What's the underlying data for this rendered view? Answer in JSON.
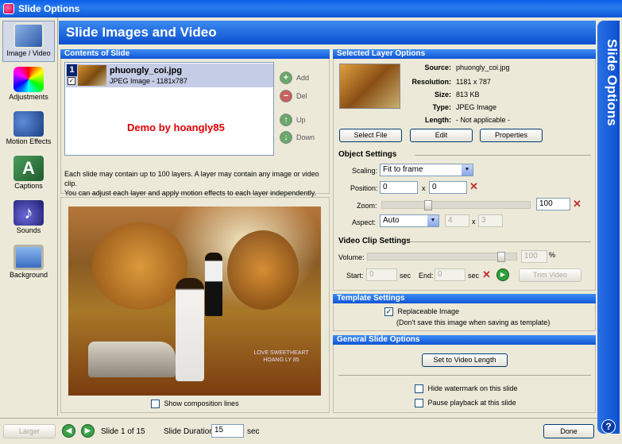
{
  "window": {
    "title": "Slide Options"
  },
  "sidebar": {
    "items": [
      {
        "label": "Image / Video",
        "icon": "image-video-icon"
      },
      {
        "label": "Adjustments",
        "icon": "adjustments-icon"
      },
      {
        "label": "Motion Effects",
        "icon": "motion-effects-icon"
      },
      {
        "label": "Captions",
        "icon": "captions-icon"
      },
      {
        "label": "Sounds",
        "icon": "sounds-icon"
      },
      {
        "label": "Background",
        "icon": "background-icon"
      }
    ]
  },
  "header": {
    "title": "Slide Images and Video",
    "side_title": "Slide Options"
  },
  "contents": {
    "section_title": "Contents of Slide",
    "layer": {
      "number": "1",
      "check": "✓",
      "name": "phuongly_coi.jpg",
      "info": "JPEG Image - 1181x787"
    },
    "demo_text": "Demo by hoangly85",
    "buttons": {
      "add": "Add",
      "del": "Del",
      "up": "Up",
      "down": "Down"
    },
    "info_line1": "Each slide may contain up to 100 layers. A layer may contain any image or video clip.",
    "info_line2": "You can adjust each layer and apply motion effects to each layer independently.",
    "show_composition": "Show composition lines"
  },
  "preview": {
    "watermark_line1": "LOVE SWEETHEART",
    "watermark_line2": "HOANG LY 85"
  },
  "selected_layer": {
    "section_title": "Selected Layer Options",
    "source_label": "Source:",
    "source": "phuongly_coi.jpg",
    "resolution_label": "Resolution:",
    "resolution": "1181 x 787",
    "size_label": "Size:",
    "size": "813 KB",
    "type_label": "Type:",
    "type": "JPEG Image",
    "length_label": "Length:",
    "length": "- Not applicable -",
    "select_file": "Select File",
    "edit": "Edit",
    "properties": "Properties"
  },
  "object_settings": {
    "title": "Object Settings",
    "scaling_label": "Scaling:",
    "scaling": "Fit to frame",
    "position_label": "Position:",
    "pos_x": "0",
    "pos_y": "0",
    "x_sep": "x",
    "zoom_label": "Zoom:",
    "zoom": "100",
    "zoom_fraction": 0.3,
    "aspect_label": "Aspect:",
    "aspect": "Auto",
    "aspect_w": "4",
    "aspect_h": "3"
  },
  "video_clip": {
    "title": "Video Clip Settings",
    "volume_label": "Volume:",
    "volume": "100",
    "percent": "%",
    "start_label": "Start:",
    "start": "0",
    "sec": "sec",
    "end_label": "End:",
    "end": "0",
    "trim_video": "Trim Video"
  },
  "template": {
    "section_title": "Template Settings",
    "replaceable": "Replaceable Image",
    "replaceable_note": "(Don't save this image when saving as template)"
  },
  "general": {
    "section_title": "General Slide Options",
    "set_video_length": "Set to Video Length",
    "hide_watermark": "Hide watermark on this slide",
    "pause_playback": "Pause playback at this slide"
  },
  "bottom": {
    "larger": "Larger",
    "slide_counter": "Slide 1 of 15",
    "duration_label": "Slide Duration:",
    "duration": "15",
    "sec": "sec",
    "done": "Done"
  },
  "help": "?"
}
